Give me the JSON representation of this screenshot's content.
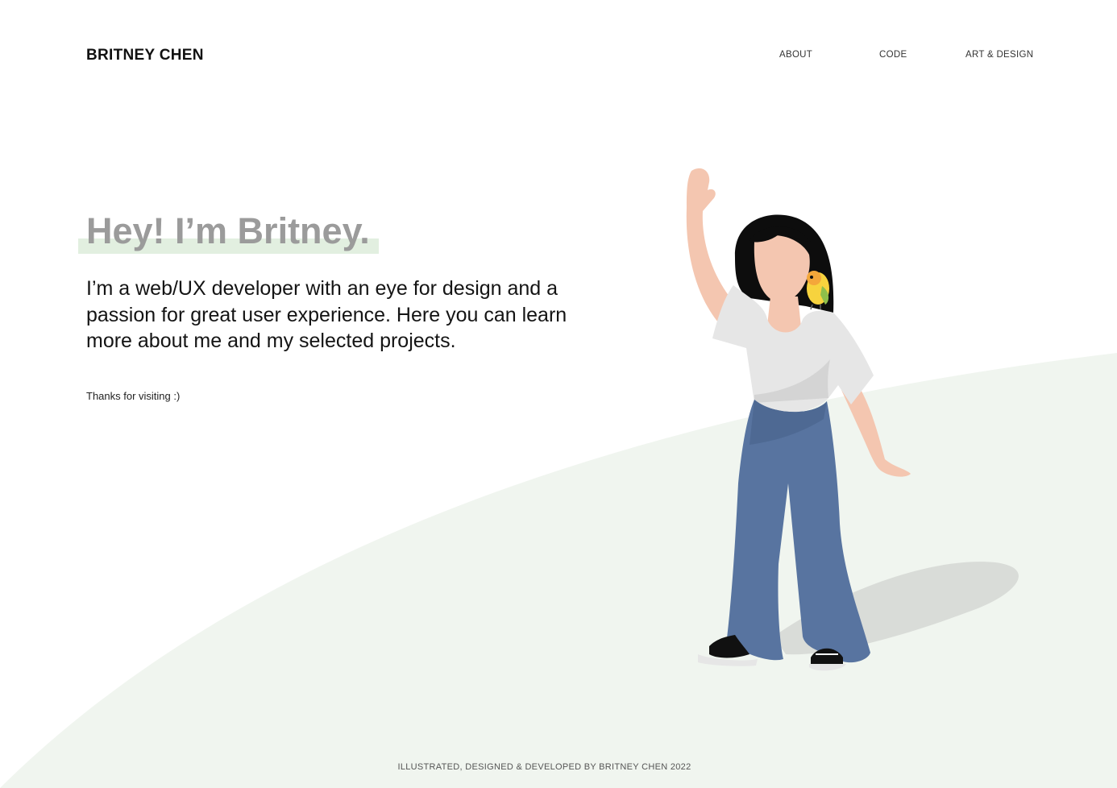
{
  "header": {
    "logo": "BRITNEY CHEN",
    "nav": [
      {
        "label": "ABOUT"
      },
      {
        "label": "CODE"
      },
      {
        "label": "ART & DESIGN"
      }
    ]
  },
  "hero": {
    "title": "Hey! I’m Britney.",
    "intro": "I’m a web/UX developer with an eye for design and a passion for great user experience. Here you can learn more about me and my selected projects.",
    "thanks": "Thanks for visiting :)"
  },
  "illustration": {
    "subject": "waving-woman-with-parrot-illustration",
    "colors": {
      "hill": "#f0f5ef",
      "skin": "#f4c6b0",
      "hair": "#0d0d0d",
      "shirt": "#e6e6e6",
      "pants": "#5874a0",
      "shadow": "#d9dcd8",
      "parrot": "#f7d33e"
    }
  },
  "footer": {
    "credit": "ILLUSTRATED, DESIGNED & DEVELOPED BY BRITNEY CHEN 2022"
  },
  "colors": {
    "accent_highlight": "#e2efe0",
    "title_gray": "#9b9b9b",
    "text": "#141414"
  }
}
